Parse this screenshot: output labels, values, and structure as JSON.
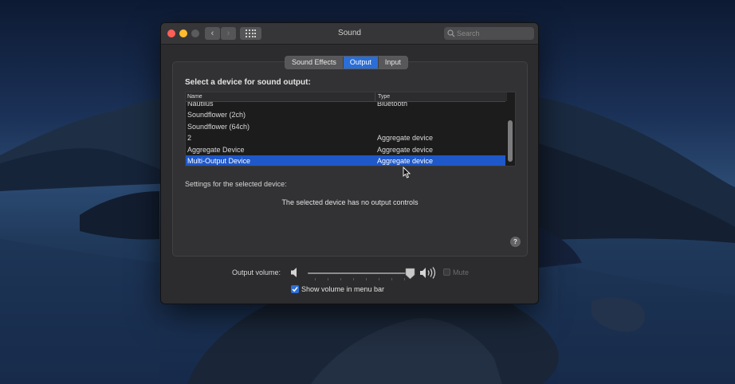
{
  "window": {
    "title": "Sound",
    "search_placeholder": "Search",
    "nav": {
      "back_glyph": "‹",
      "forward_glyph": "›"
    },
    "tabs": [
      {
        "label": "Sound Effects",
        "active": false
      },
      {
        "label": "Output",
        "active": true
      },
      {
        "label": "Input",
        "active": false
      }
    ]
  },
  "output": {
    "heading": "Select a device for sound output:",
    "columns": {
      "name": "Name",
      "type": "Type"
    },
    "devices": [
      {
        "name": "Nautilus",
        "type": "Bluetooth"
      },
      {
        "name": "Soundflower (2ch)",
        "type": ""
      },
      {
        "name": "Soundflower (64ch)",
        "type": ""
      },
      {
        "name": "2",
        "type": "Aggregate device"
      },
      {
        "name": "Aggregate Device",
        "type": "Aggregate device"
      },
      {
        "name": "Multi-Output Device",
        "type": "Aggregate device",
        "selected": true
      }
    ],
    "settings_label": "Settings for the selected device:",
    "no_controls_message": "The selected device has no output controls",
    "help_glyph": "?"
  },
  "volume": {
    "label": "Output volume:",
    "level": 0.94,
    "mute_label": "Mute",
    "mute_checked": false,
    "show_in_menu_bar_label": "Show volume in menu bar",
    "show_in_menu_bar_checked": true
  },
  "colors": {
    "accent": "#2a6ed8",
    "selection": "#1f58c8",
    "window_bg": "#2c2c2e",
    "close_light": "#fd5f57",
    "minimize_light": "#febc2e"
  },
  "icons": [
    "back-arrow-icon",
    "forward-arrow-icon",
    "grid-icon",
    "search-icon",
    "speaker-low-icon",
    "speaker-high-icon",
    "help-icon",
    "checkmark-icon",
    "pointer-cursor-icon"
  ]
}
